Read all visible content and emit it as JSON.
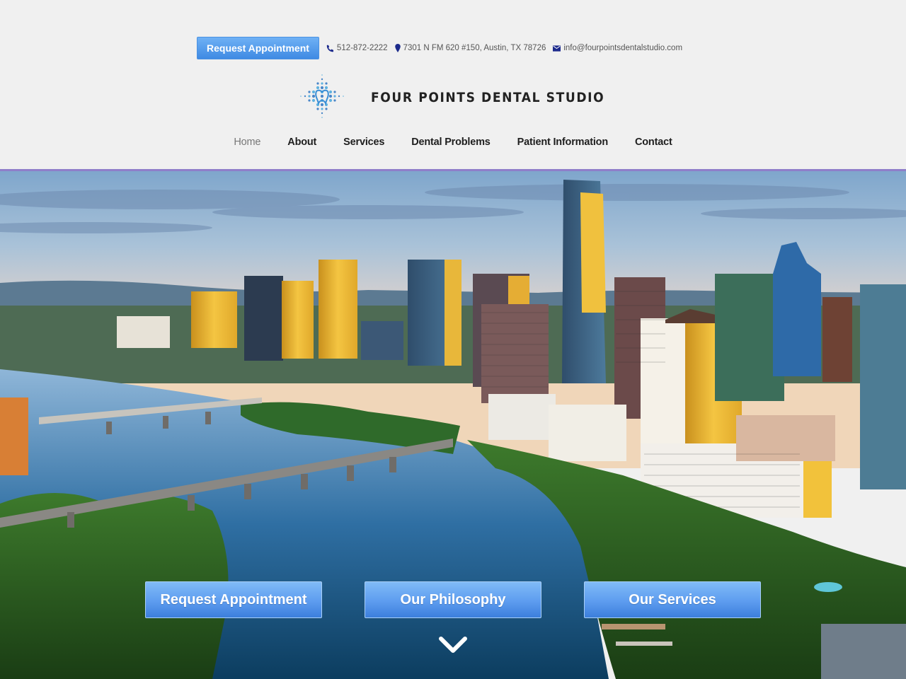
{
  "topbar": {
    "request_button": "Request Appointment",
    "phone": "512-872-2222",
    "address": "7301 N FM 620 #150, Austin, TX 78726",
    "email": "info@fourpointsdentalstudio.com",
    "icons": {
      "phone": "phone-icon",
      "address": "map-marker-icon",
      "email": "envelope-icon"
    },
    "icon_color": "#1c2a8c"
  },
  "brand": {
    "name": "FOUR POINTS DENTAL STUDIO",
    "logo": "tooth-cross-logo"
  },
  "nav": {
    "items": [
      {
        "label": "Home",
        "active": true
      },
      {
        "label": "About"
      },
      {
        "label": "Services"
      },
      {
        "label": "Dental Problems"
      },
      {
        "label": "Patient Information"
      },
      {
        "label": "Contact"
      }
    ]
  },
  "hero": {
    "image": "Austin skyline aerial view over Lady Bird Lake",
    "buttons": [
      {
        "label": "Request Appointment"
      },
      {
        "label": "Our Philosophy"
      },
      {
        "label": "Our Services"
      }
    ],
    "scroll_icon": "chevron-down-icon"
  },
  "colors": {
    "header_bg": "#f0f0f0",
    "accent_rule": "#8f7ec9",
    "button_blue": "#5d9cef"
  }
}
